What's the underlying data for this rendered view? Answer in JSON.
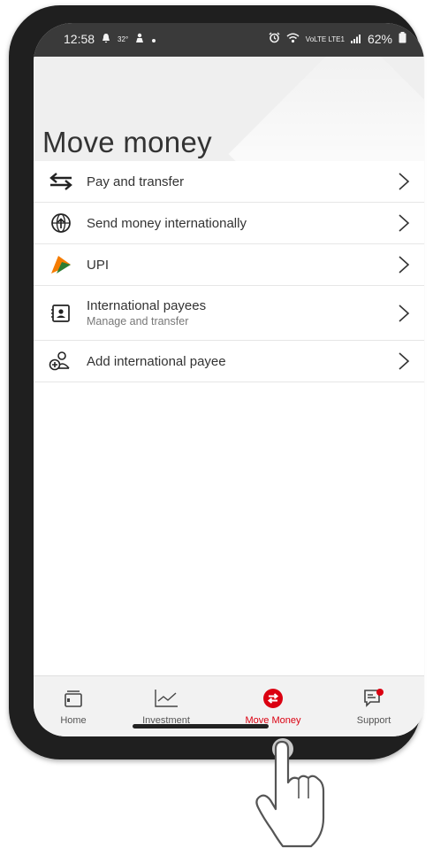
{
  "status_bar": {
    "time": "12:58",
    "temperature": "32°",
    "network_mini": "VoLTE LTE1",
    "battery": "62%"
  },
  "header": {
    "title": "Move money"
  },
  "menu": {
    "items": [
      {
        "label": "Pay and transfer",
        "icon": "transfer-arrows-icon"
      },
      {
        "label": "Send money internationally",
        "icon": "globe-arrow-icon"
      },
      {
        "label": "UPI",
        "icon": "upi-logo-icon"
      },
      {
        "label": "International payees",
        "sublabel": "Manage and transfer",
        "icon": "payee-card-icon"
      },
      {
        "label": "Add international payee",
        "icon": "add-person-icon"
      }
    ]
  },
  "bottom_nav": {
    "items": [
      {
        "label": "Home",
        "icon": "wallet-icon",
        "active": false
      },
      {
        "label": "Investment",
        "icon": "line-chart-icon",
        "active": false
      },
      {
        "label": "Move Money",
        "icon": "move-money-icon",
        "active": true
      },
      {
        "label": "Support",
        "icon": "chat-badge-icon",
        "active": false
      }
    ]
  },
  "colors": {
    "accent": "#db0011",
    "upi_orange": "#f57c00",
    "upi_green": "#2e7d32",
    "text": "#333333",
    "header_bg": "#efefef",
    "status_bar_bg": "#3a3a3a"
  }
}
